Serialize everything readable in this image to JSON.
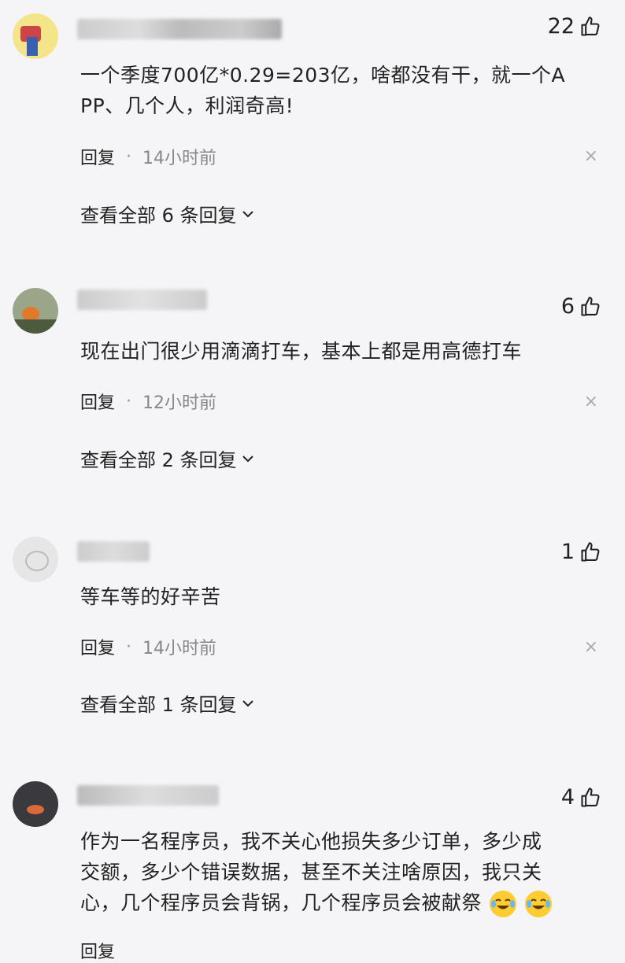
{
  "comments": [
    {
      "likes": "22",
      "text_lines": [
        "一个季度700亿*0.29=203亿，啥都没有干，就一个A",
        "PP、几个人，利润奇高!"
      ],
      "reply_label": "回复",
      "time": "14小时前",
      "view_all": "查看全部 6 条回复"
    },
    {
      "likes": "6",
      "text_lines": [
        "现在出门很少用滴滴打车，基本上都是用高德打车"
      ],
      "reply_label": "回复",
      "time": "12小时前",
      "view_all": "查看全部 2 条回复"
    },
    {
      "likes": "1",
      "text_lines": [
        "等车等的好辛苦"
      ],
      "reply_label": "回复",
      "time": "14小时前",
      "view_all": "查看全部 1 条回复"
    },
    {
      "likes": "4",
      "text_lines": [
        "作为一名程序员，我不关心他损失多少订单，多少成",
        "交额，多少个错误数据，甚至不关注啥原因，我只关",
        "心，几个程序员会背锅，几个程序员会被献祭"
      ],
      "reply_label": "回复"
    }
  ],
  "icons": {
    "like": "thumbs-up-icon",
    "close": "close-icon",
    "chevron": "chevron-down-icon",
    "emoji": "crying-laughing-emoji-icon"
  },
  "colors": {
    "background": "#f5f5f7",
    "text": "#222222",
    "meta": "#888888"
  },
  "close_glyph": "×"
}
